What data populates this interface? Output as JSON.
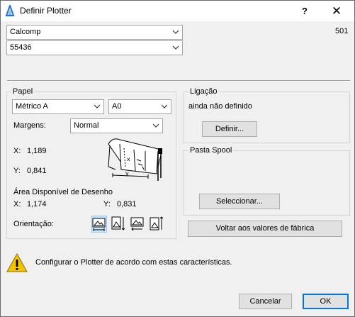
{
  "window": {
    "title": "Definir Plotter",
    "help_glyph": "?",
    "close_glyph": "✕"
  },
  "top": {
    "plotter_model": "Calcomp",
    "plotter_variant": "55436",
    "model_number": "501"
  },
  "paper": {
    "group_title": "Papel",
    "paper_type": "Métrico A",
    "paper_size": "A0",
    "margins_label": "Margens:",
    "margins_value": "Normal",
    "x_label": "X:",
    "x_value": "1,189",
    "y_label": "Y:",
    "y_value": "0,841",
    "drawable_area_label": "Área Disponível de Desenho",
    "area_x_label": "X:",
    "area_x_value": "1,174",
    "area_y_label": "Y:",
    "area_y_value": "0,831",
    "orientation_label": "Orientação:"
  },
  "connection": {
    "group_title": "Ligação",
    "status": "ainda não definido",
    "define_button": "Definir..."
  },
  "spool": {
    "group_title": "Pasta Spool",
    "select_button": "Seleccionar..."
  },
  "reset_button": "Voltar aos valores de fábrica",
  "message": {
    "text": "Configurar o Plotter de acordo com estas características."
  },
  "footer": {
    "cancel_button": "Cancelar",
    "ok_button": "OK"
  },
  "colors": {
    "accent": "#0078d7",
    "selected_bg": "#cce4f7",
    "warning": "#f5c400",
    "app_icon": "#1e6fd9"
  },
  "icons": [
    "plotter-app-icon",
    "chevron-down-icon",
    "plotter-illustration-icon",
    "landscape-orientation-icon",
    "warning-icon"
  ]
}
